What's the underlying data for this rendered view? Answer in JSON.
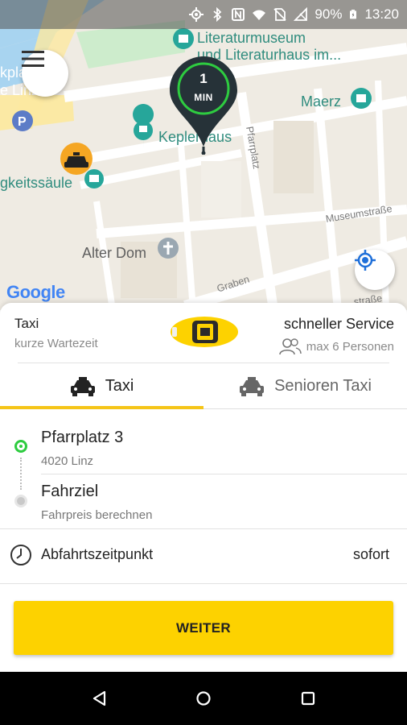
{
  "status_bar": {
    "battery": "90%",
    "time": "13:20"
  },
  "map": {
    "labels": {
      "literaturmuseum_line1": "Literaturmuseum",
      "literaturmuseum_line2": "und Literaturhaus im...",
      "maerz": "Maerz",
      "keplerhaus": "Keplerhaus",
      "pfarrplatz": "Pfarrplatz",
      "saeule": "gkeitssäule",
      "alter_dom": "Alter Dom",
      "museumstrasse": "Museumstraße",
      "graben": "Graben",
      "edge_top": "kpla",
      "edge_linz": "e Linz",
      "edge_bottom": "straße",
      "google": "Google"
    },
    "pin": {
      "value": "1",
      "unit": "MIN"
    }
  },
  "service": {
    "left_title": "Taxi",
    "left_subtitle": "kurze Wartezeit",
    "right_title": "schneller Service",
    "right_subtitle": "max 6 Personen"
  },
  "tabs": [
    {
      "label": "Taxi",
      "active": true
    },
    {
      "label": "Senioren Taxi",
      "active": false
    }
  ],
  "route": {
    "pickup_title": "Pfarrplatz 3",
    "pickup_subtitle": "4020 Linz",
    "destination_title": "Fahrziel",
    "destination_subtitle": "Fahrpreis berechnen"
  },
  "departure": {
    "label": "Abfahrtszeitpunkt",
    "value": "sofort"
  },
  "cta": {
    "label": "WEITER"
  },
  "colors": {
    "accent": "#fdd200",
    "pickup_dot": "#2ecc40",
    "pin": "#263238",
    "poi_teal": "#26a69a"
  }
}
